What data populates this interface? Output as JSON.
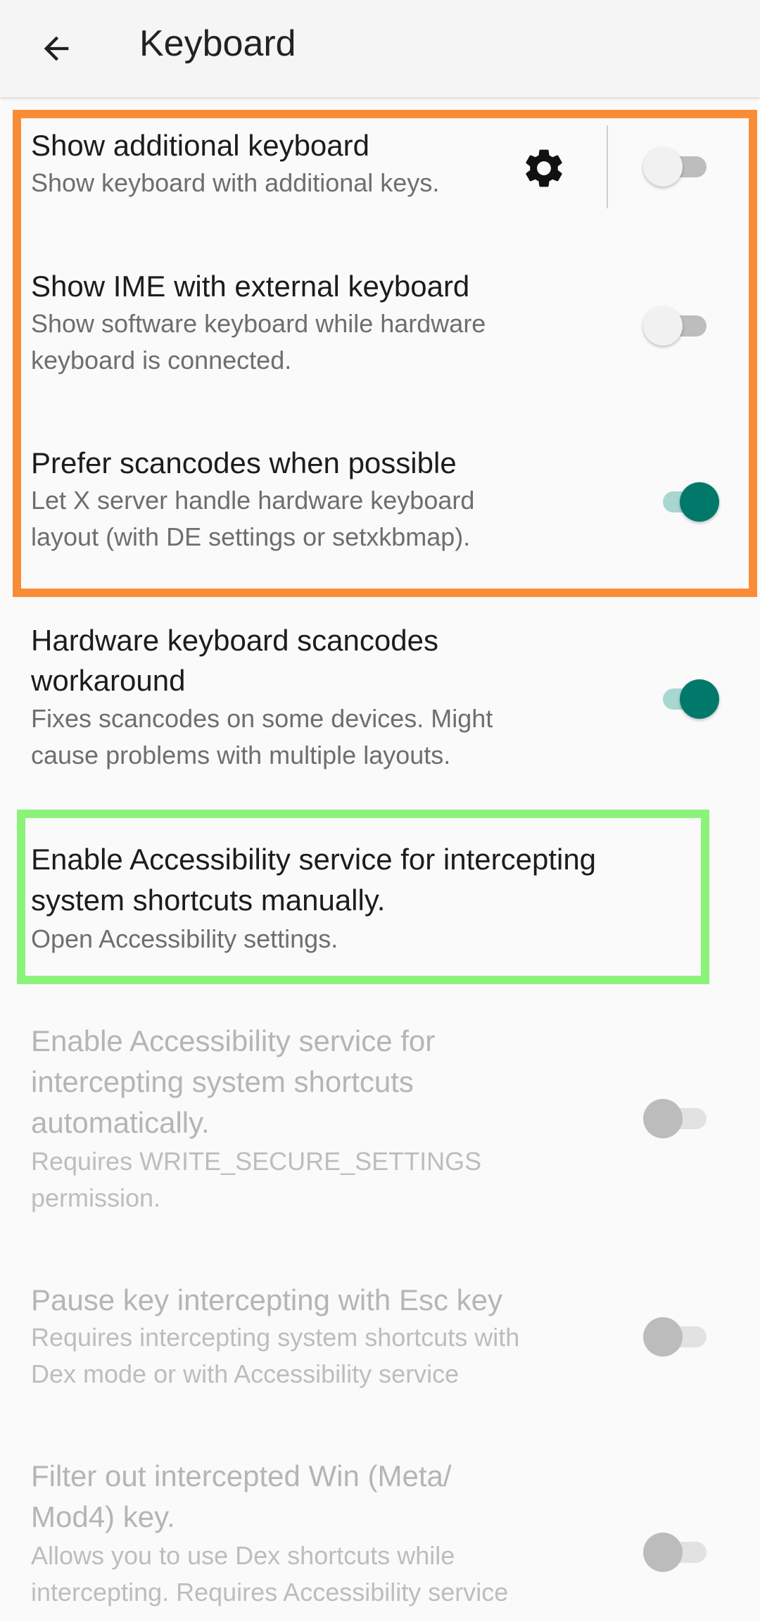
{
  "app_bar": {
    "title": "Keyboard",
    "back_icon": "arrow-left-icon"
  },
  "preferences": [
    {
      "title": "Show additional keyboard",
      "summary": "Show keyboard with additional keys.",
      "settings_icon": "gear-icon",
      "switch_on": false,
      "enabled": true
    },
    {
      "title": "Show IME with external keyboard",
      "summary_line1": "Show software keyboard while hardware",
      "summary_line2": "keyboard is connected.",
      "switch_on": false,
      "enabled": true
    },
    {
      "title": "Prefer scancodes when possible",
      "summary_line1": "Let X server handle hardware keyboard",
      "summary_line2": "layout (with DE settings or setxkbmap).",
      "switch_on": true,
      "enabled": true
    },
    {
      "title_line1": "Hardware keyboard scancodes",
      "title_line2": "workaround",
      "summary_line1": "Fixes scancodes on some devices. Might",
      "summary_line2": "cause problems with multiple layouts.",
      "switch_on": true,
      "enabled": true
    },
    {
      "title_line1": "Enable Accessibility service for intercepting",
      "title_line2": "system shortcuts manually.",
      "summary": "Open Accessibility settings.",
      "enabled": true
    },
    {
      "title_line1": "Enable Accessibility service for",
      "title_line2": "intercepting system shortcuts",
      "title_line3": "automatically.",
      "summary_line1": "Requires WRITE_SECURE_SETTINGS",
      "summary_line2": "permission.",
      "switch_on": false,
      "enabled": false
    },
    {
      "title": "Pause key intercepting with Esc key",
      "summary_line1": "Requires intercepting system shortcuts with",
      "summary_line2": "Dex mode or with Accessibility service",
      "switch_on": false,
      "enabled": false
    },
    {
      "title_line1": "Filter out intercepted Win (Meta/",
      "title_line2": "Mod4) key.",
      "summary_line1": "Allows you to use Dex shortcuts while",
      "summary_line2": "intercepting. Requires Accessibility service",
      "switch_on": false,
      "enabled": false
    }
  ],
  "colors": {
    "accent": "#00796b",
    "highlight_orange": "#fb8c37",
    "highlight_green": "#8bf37a"
  }
}
